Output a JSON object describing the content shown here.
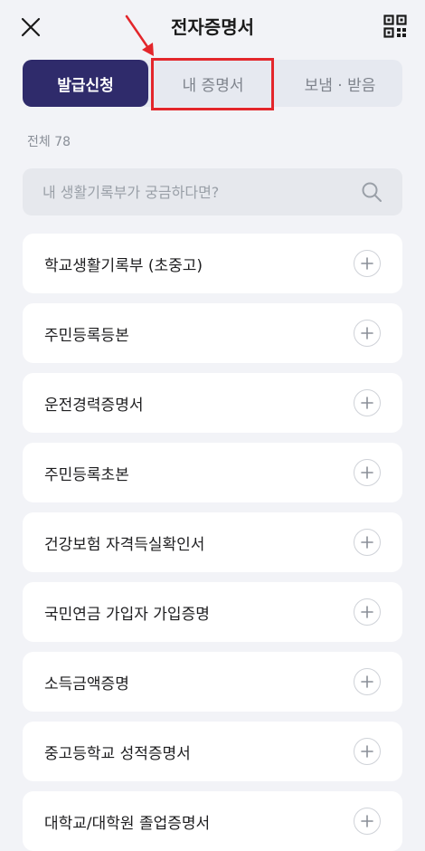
{
  "header": {
    "title": "전자증명서",
    "close_icon": "close-icon",
    "qr_icon": "qr-code-icon"
  },
  "tabs": [
    {
      "label": "발급신청",
      "active": true
    },
    {
      "label": "내 증명서",
      "active": false
    },
    {
      "label": "보냄 · 받음",
      "active": false
    }
  ],
  "count_label": "전체 78",
  "search": {
    "placeholder": "내 생활기록부가 궁금하다면?",
    "icon": "search-icon"
  },
  "items": [
    {
      "label": "학교생활기록부 (초중고)"
    },
    {
      "label": "주민등록등본"
    },
    {
      "label": "운전경력증명서"
    },
    {
      "label": "주민등록초본"
    },
    {
      "label": "건강보험 자격득실확인서"
    },
    {
      "label": "국민연금 가입자 가입증명"
    },
    {
      "label": "소득금액증명"
    },
    {
      "label": "중고등학교 성적증명서"
    },
    {
      "label": "대학교/대학원 졸업증명서"
    }
  ],
  "colors": {
    "active_tab": "#2f2b6b",
    "highlight": "#e3262b",
    "background": "#f2f3f7"
  }
}
